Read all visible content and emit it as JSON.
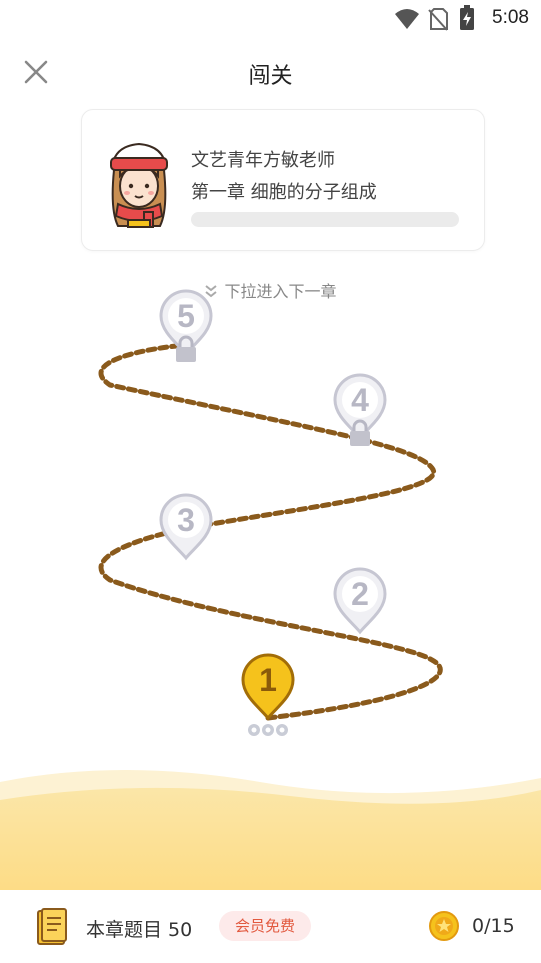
{
  "status_bar": {
    "time": "5:08",
    "icons": [
      "wifi-icon",
      "no-sim-icon",
      "battery-charging-icon"
    ]
  },
  "header": {
    "title": "闯关",
    "close_icon": "close-icon"
  },
  "teacher_card": {
    "teacher_name": "文艺青年方敏老师",
    "chapter": "第一章 细胞的分子组成",
    "progress": 0
  },
  "pull_hint": "下拉进入下一章",
  "levels": [
    {
      "number": "1",
      "state": "current"
    },
    {
      "number": "2",
      "state": "inactive"
    },
    {
      "number": "3",
      "state": "inactive"
    },
    {
      "number": "4",
      "state": "locked"
    },
    {
      "number": "5",
      "state": "locked"
    }
  ],
  "colors": {
    "path": "#8a5a1c",
    "current_pin": "#f5c21c",
    "current_pin_stroke": "#a26d08",
    "inactive_pin": "#f0f0f4",
    "inactive_pin_stroke": "#c6c6d2",
    "wave": "#fbe4a1",
    "vip_text": "#e2593f",
    "vip_bg": "#fdeaea"
  },
  "bottom_bar": {
    "chapter_questions": "本章题目 50",
    "vip_label": "会员免费",
    "coins": "0/15"
  }
}
